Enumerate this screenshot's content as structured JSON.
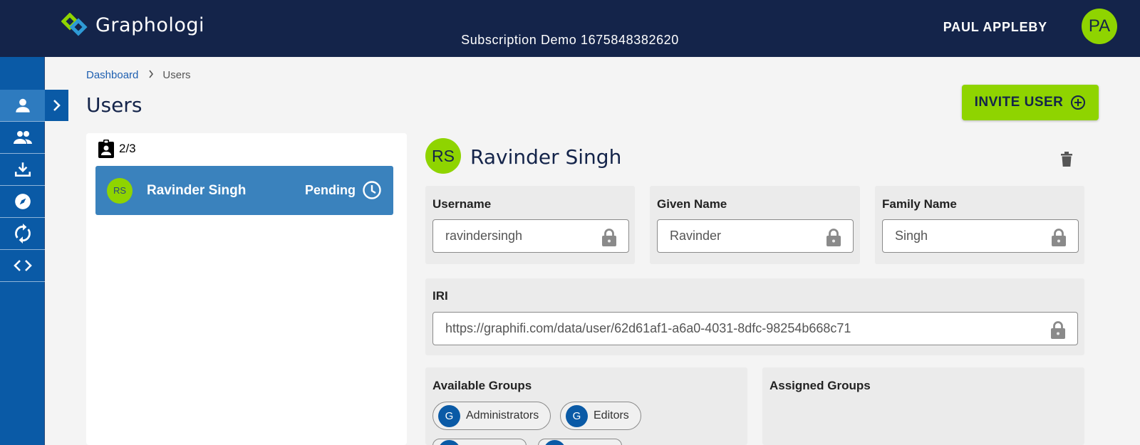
{
  "app": {
    "name": "Graphologi",
    "subscription": "Subscription Demo 1675848382620"
  },
  "user": {
    "name": "PAUL APPLEBY",
    "initials": "PA"
  },
  "sidebar": {
    "items": [
      {
        "icon": "person-icon",
        "active": true
      },
      {
        "icon": "people-icon",
        "active": false
      },
      {
        "icon": "download-icon",
        "active": false
      },
      {
        "icon": "compass-icon",
        "active": false
      },
      {
        "icon": "sync-icon",
        "active": false
      },
      {
        "icon": "code-icon",
        "active": false
      }
    ]
  },
  "breadcrumb": {
    "link": "Dashboard",
    "current": "Users"
  },
  "page": {
    "title": "Users"
  },
  "invite_button": {
    "label": "INVITE USER"
  },
  "user_list": {
    "count": "2/3",
    "items": [
      {
        "initials": "RS",
        "name": "Ravinder Singh",
        "status": "Pending"
      }
    ]
  },
  "detail": {
    "initials": "RS",
    "name": "Ravinder Singh",
    "fields": {
      "username": {
        "label": "Username",
        "value": "ravindersingh"
      },
      "given_name": {
        "label": "Given Name",
        "value": "Ravinder"
      },
      "family_name": {
        "label": "Family Name",
        "value": "Singh"
      },
      "iri": {
        "label": "IRI",
        "value": "https://graphifi.com/data/user/62d61af1-a6a0-4031-8dfc-98254b668c71"
      }
    },
    "available_groups": {
      "label": "Available Groups",
      "groups": [
        {
          "initial": "G",
          "name": "Administrators"
        },
        {
          "initial": "G",
          "name": "Editors"
        }
      ]
    },
    "assigned_groups": {
      "label": "Assigned Groups"
    }
  },
  "colors": {
    "header": "#14244a",
    "sidebar": "#0a5aa6",
    "accent": "#8fd400",
    "selected_row": "#3a82bd"
  }
}
